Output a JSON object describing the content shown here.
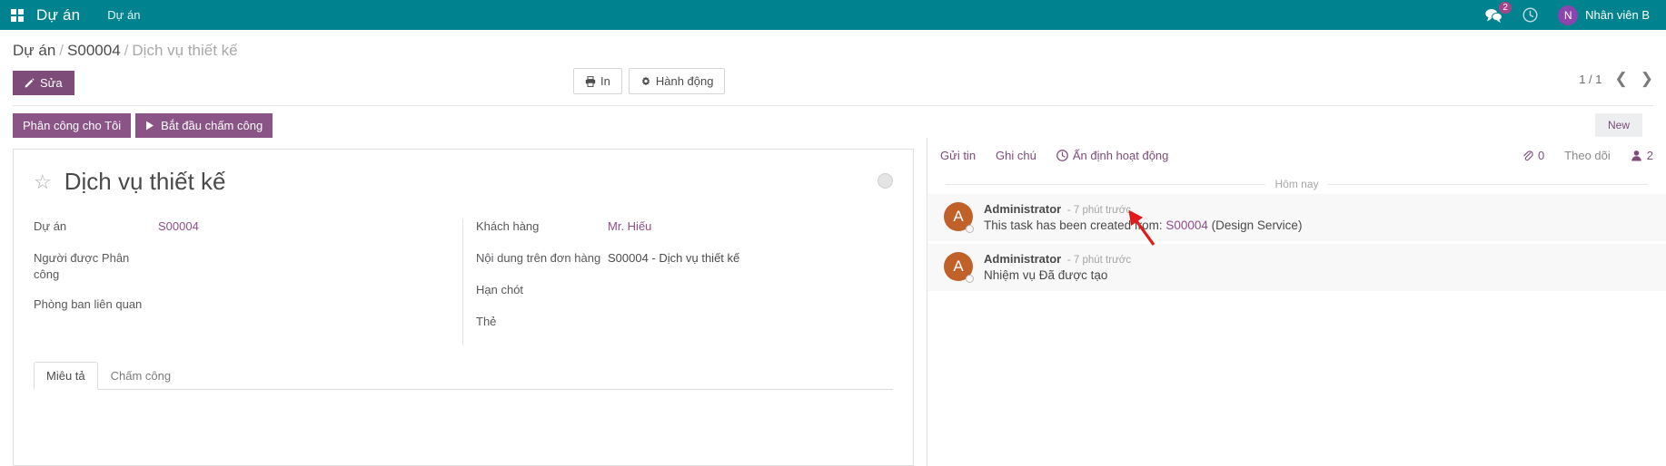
{
  "navbar": {
    "apps_icon": "apps-grid-icon",
    "brand": "Dự án",
    "menu": "Dự án",
    "messages_icon": "messages-icon",
    "messages_count": "2",
    "activities_icon": "clock-icon",
    "user_initial": "N",
    "user_name": "Nhân viên B"
  },
  "breadcrumb": {
    "root": "Dự án",
    "sep": "/",
    "parent": "S00004",
    "current": "Dịch vụ thiết kế"
  },
  "controls": {
    "edit_label": "Sửa",
    "edit_icon": "pencil-icon",
    "print_label": "In",
    "print_icon": "printer-icon",
    "action_label": "Hành động",
    "action_icon": "gear-icon",
    "pager_text": "1 / 1",
    "prev_icon": "chevron-left-icon",
    "next_icon": "chevron-right-icon"
  },
  "statusbar": {
    "assign_label": "Phân công cho Tôi",
    "timer_label": "Bắt đầu chấm công",
    "timer_icon": "play-icon",
    "status": "New"
  },
  "form": {
    "star_icon": "star-icon",
    "title": "Dịch vụ thiết kế",
    "kanban_state_icon": "kanban-state-dot",
    "left_fields": [
      {
        "label": "Dự án",
        "value": "S00004",
        "link": true
      },
      {
        "label": "Người được Phân công",
        "value": "",
        "link": false
      },
      {
        "label": "Phòng ban liên quan",
        "value": "",
        "link": false
      }
    ],
    "right_fields": [
      {
        "label": "Khách hàng",
        "value": "Mr. Hiếu",
        "link": true
      },
      {
        "label": "Nội dung trên đơn hàng",
        "value": "S00004 - Dịch vụ thiết kế",
        "link": false
      },
      {
        "label": "Hạn chót",
        "value": "",
        "link": false
      },
      {
        "label": "Thẻ",
        "value": "",
        "link": false
      }
    ],
    "tabs": [
      {
        "label": "Miêu tả",
        "active": true
      },
      {
        "label": "Chấm công",
        "active": false
      }
    ]
  },
  "chatter": {
    "send_message": "Gửi tin",
    "log_note": "Ghi chú",
    "schedule_activity": "Ấn định hoạt động",
    "schedule_icon": "clock-icon",
    "attachment_icon": "paperclip-icon",
    "attachment_count": "0",
    "follow_label": "Theo dõi",
    "followers_icon": "user-icon",
    "followers_count": "2",
    "day_separator": "Hôm nay",
    "messages": [
      {
        "initial": "A",
        "author": "Administrator",
        "time": "- 7 phút trước",
        "body_prefix": "This task has been created from: ",
        "body_link": "S00004",
        "body_suffix": " (Design Service)"
      },
      {
        "initial": "A",
        "author": "Administrator",
        "time": "- 7 phút trước",
        "body_prefix": "Nhiệm vụ Đã được tạo",
        "body_link": "",
        "body_suffix": ""
      }
    ]
  },
  "annotation": {
    "arrow_color": "#e01b1b"
  },
  "colors": {
    "navbar": "#00838f",
    "primary": "#7d4c79",
    "link": "#8f4e8b",
    "badge": "#a24689"
  }
}
